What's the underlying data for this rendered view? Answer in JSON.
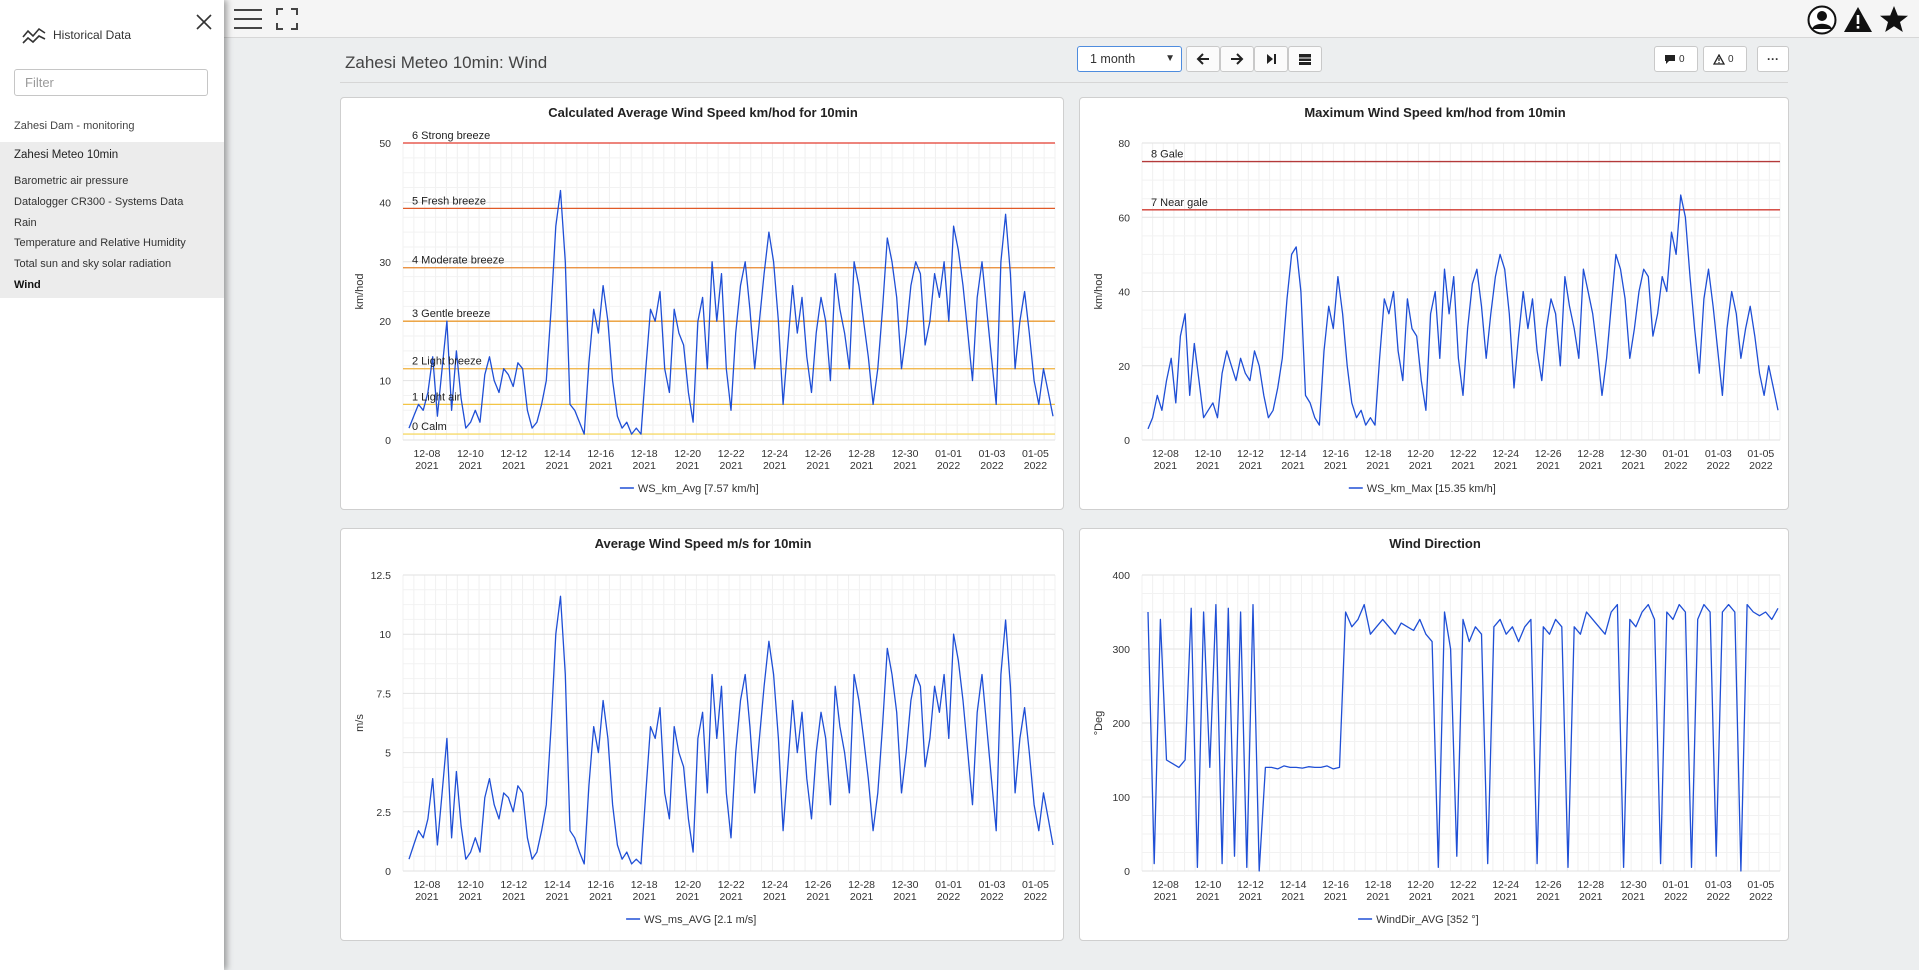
{
  "sidebar": {
    "title": "Historical Data",
    "filter_placeholder": "Filter",
    "section": "Zahesi Dam - monitoring",
    "group": "Zahesi Meteo 10min",
    "items": [
      {
        "label": "Barometric air pressure",
        "active": false
      },
      {
        "label": "Datalogger CR300 - Systems Data",
        "active": false
      },
      {
        "label": "Rain",
        "active": false
      },
      {
        "label": "Temperature and Relative Humidity",
        "active": false
      },
      {
        "label": "Total sun and sky solar radiation",
        "active": false
      },
      {
        "label": "Wind",
        "active": true
      }
    ]
  },
  "toolbar": {
    "icons": [
      "menu-icon",
      "fullscreen-icon",
      "user-icon",
      "warning-icon",
      "star-icon"
    ]
  },
  "page": {
    "title": "Zahesi Meteo 10min: Wind",
    "period": "1 month",
    "comments_count": "0",
    "alarms_count": "0",
    "more_label": "···"
  },
  "colors": {
    "series": "#1f4fd6",
    "accent": "#4e8cde"
  },
  "chart_data": [
    {
      "type": "line",
      "title": "Calculated Average Wind Speed km/hod for 10min",
      "ylabel": "km/hod",
      "ylim": [
        0,
        50
      ],
      "yticks": [
        "0",
        "10",
        "20",
        "30",
        "40",
        "50"
      ],
      "x_ticks": [
        {
          "date": "12-08",
          "year": "2021"
        },
        {
          "date": "12-10",
          "year": "2021"
        },
        {
          "date": "12-12",
          "year": "2021"
        },
        {
          "date": "12-14",
          "year": "2021"
        },
        {
          "date": "12-16",
          "year": "2021"
        },
        {
          "date": "12-18",
          "year": "2021"
        },
        {
          "date": "12-20",
          "year": "2021"
        },
        {
          "date": "12-22",
          "year": "2021"
        },
        {
          "date": "12-24",
          "year": "2021"
        },
        {
          "date": "12-26",
          "year": "2021"
        },
        {
          "date": "12-28",
          "year": "2021"
        },
        {
          "date": "12-30",
          "year": "2021"
        },
        {
          "date": "01-01",
          "year": "2022"
        },
        {
          "date": "01-03",
          "year": "2022"
        },
        {
          "date": "01-05",
          "year": "2022"
        }
      ],
      "x_start": "2021-12-07",
      "x_end": "2022-01-06",
      "series": [
        {
          "name": "WS_km_Avg",
          "legend": "WS_km_Avg [7.57 km/h]",
          "y": [
            2,
            4,
            6,
            5,
            8,
            14,
            4,
            12,
            20,
            5,
            15,
            7,
            2,
            3,
            5,
            3,
            11,
            14,
            10,
            8,
            12,
            11,
            9,
            13,
            12,
            5,
            2,
            3,
            6,
            10,
            22,
            36,
            42,
            30,
            6,
            5,
            3,
            1,
            13,
            22,
            18,
            26,
            20,
            10,
            4,
            2,
            3,
            1,
            2,
            1,
            12,
            22,
            20,
            25,
            12,
            8,
            22,
            18,
            16,
            8,
            3,
            20,
            24,
            12,
            30,
            20,
            28,
            12,
            5,
            18,
            26,
            30,
            22,
            12,
            20,
            28,
            35,
            30,
            20,
            6,
            16,
            26,
            18,
            24,
            14,
            8,
            18,
            24,
            20,
            10,
            28,
            22,
            18,
            12,
            30,
            26,
            20,
            14,
            6,
            12,
            22,
            34,
            30,
            24,
            12,
            18,
            26,
            30,
            28,
            16,
            20,
            28,
            24,
            30,
            20,
            36,
            32,
            26,
            18,
            10,
            24,
            30,
            22,
            14,
            6,
            30,
            38,
            28,
            12,
            20,
            25,
            18,
            10,
            6,
            12,
            8,
            4
          ]
        }
      ],
      "thresholds": [
        {
          "value": 50,
          "label": "6 Strong breeze",
          "color": "#e23a2e"
        },
        {
          "value": 39,
          "label": "5 Fresh breeze",
          "color": "#e05a28"
        },
        {
          "value": 29,
          "label": "4 Moderate breeze",
          "color": "#e8862c"
        },
        {
          "value": 20,
          "label": "3 Gentle breeze",
          "color": "#ec9b30"
        },
        {
          "value": 12,
          "label": "2 Light breeze",
          "color": "#f0b03a"
        },
        {
          "value": 6,
          "label": "1 Light air",
          "color": "#f3c545"
        },
        {
          "value": 1,
          "label": "0 Calm",
          "color": "#f6da6a"
        }
      ]
    },
    {
      "type": "line",
      "title": "Maximum Wind Speed km/hod from 10min",
      "ylabel": "km/hod",
      "ylim": [
        0,
        80
      ],
      "yticks": [
        "0",
        "20",
        "40",
        "60",
        "80"
      ],
      "x_ticks": [
        {
          "date": "12-08",
          "year": "2021"
        },
        {
          "date": "12-10",
          "year": "2021"
        },
        {
          "date": "12-12",
          "year": "2021"
        },
        {
          "date": "12-14",
          "year": "2021"
        },
        {
          "date": "12-16",
          "year": "2021"
        },
        {
          "date": "12-18",
          "year": "2021"
        },
        {
          "date": "12-20",
          "year": "2021"
        },
        {
          "date": "12-22",
          "year": "2021"
        },
        {
          "date": "12-24",
          "year": "2021"
        },
        {
          "date": "12-26",
          "year": "2021"
        },
        {
          "date": "12-28",
          "year": "2021"
        },
        {
          "date": "12-30",
          "year": "2021"
        },
        {
          "date": "01-01",
          "year": "2022"
        },
        {
          "date": "01-03",
          "year": "2022"
        },
        {
          "date": "01-05",
          "year": "2022"
        }
      ],
      "x_start": "2021-12-07",
      "x_end": "2022-01-06",
      "series": [
        {
          "name": "WS_km_Max",
          "legend": "WS_km_Max [15.35 km/h]",
          "y": [
            3,
            6,
            12,
            8,
            16,
            22,
            10,
            28,
            34,
            12,
            26,
            16,
            6,
            8,
            10,
            6,
            18,
            24,
            20,
            16,
            22,
            18,
            16,
            24,
            20,
            12,
            6,
            8,
            14,
            22,
            38,
            50,
            52,
            40,
            12,
            10,
            6,
            4,
            24,
            36,
            30,
            44,
            34,
            20,
            10,
            6,
            8,
            4,
            6,
            4,
            22,
            38,
            34,
            40,
            24,
            16,
            38,
            30,
            28,
            16,
            8,
            34,
            40,
            22,
            46,
            34,
            44,
            22,
            12,
            30,
            42,
            46,
            36,
            22,
            34,
            44,
            50,
            46,
            34,
            14,
            28,
            40,
            30,
            38,
            24,
            16,
            30,
            38,
            34,
            20,
            44,
            36,
            30,
            22,
            46,
            40,
            34,
            24,
            12,
            22,
            36,
            50,
            46,
            38,
            22,
            30,
            40,
            46,
            44,
            28,
            34,
            44,
            40,
            56,
            50,
            66,
            60,
            44,
            30,
            18,
            38,
            46,
            36,
            24,
            12,
            30,
            40,
            34,
            22,
            30,
            36,
            28,
            18,
            12,
            20,
            14,
            8
          ]
        }
      ],
      "thresholds": [
        {
          "value": 75,
          "label": "8 Gale",
          "color": "#b43a3a"
        },
        {
          "value": 62,
          "label": "7 Near gale",
          "color": "#d03a30"
        }
      ]
    },
    {
      "type": "line",
      "title": "Average Wind Speed m/s for 10min",
      "ylabel": "m/s",
      "ylim": [
        0,
        12.5
      ],
      "yticks": [
        "0",
        "2.5",
        "5",
        "7.5",
        "10",
        "12.5"
      ],
      "x_ticks": [
        {
          "date": "12-08",
          "year": "2021"
        },
        {
          "date": "12-10",
          "year": "2021"
        },
        {
          "date": "12-12",
          "year": "2021"
        },
        {
          "date": "12-14",
          "year": "2021"
        },
        {
          "date": "12-16",
          "year": "2021"
        },
        {
          "date": "12-18",
          "year": "2021"
        },
        {
          "date": "12-20",
          "year": "2021"
        },
        {
          "date": "12-22",
          "year": "2021"
        },
        {
          "date": "12-24",
          "year": "2021"
        },
        {
          "date": "12-26",
          "year": "2021"
        },
        {
          "date": "12-28",
          "year": "2021"
        },
        {
          "date": "12-30",
          "year": "2021"
        },
        {
          "date": "01-01",
          "year": "2022"
        },
        {
          "date": "01-03",
          "year": "2022"
        },
        {
          "date": "01-05",
          "year": "2022"
        }
      ],
      "x_start": "2021-12-07",
      "x_end": "2022-01-06",
      "series": [
        {
          "name": "WS_ms_AVG",
          "legend": "WS_ms_AVG [2.1 m/s]",
          "y": [
            0.5,
            1.1,
            1.7,
            1.4,
            2.2,
            3.9,
            1.1,
            3.3,
            5.6,
            1.4,
            4.2,
            1.9,
            0.5,
            0.8,
            1.4,
            0.8,
            3.1,
            3.9,
            2.8,
            2.2,
            3.3,
            3.1,
            2.5,
            3.6,
            3.3,
            1.4,
            0.5,
            0.8,
            1.7,
            2.8,
            6.1,
            10.0,
            11.6,
            8.3,
            1.7,
            1.4,
            0.8,
            0.3,
            3.6,
            6.1,
            5.0,
            7.2,
            5.6,
            2.8,
            1.1,
            0.5,
            0.8,
            0.3,
            0.5,
            0.3,
            3.3,
            6.1,
            5.6,
            6.9,
            3.3,
            2.2,
            6.1,
            5.0,
            4.4,
            2.2,
            0.8,
            5.6,
            6.7,
            3.3,
            8.3,
            5.6,
            7.8,
            3.3,
            1.4,
            5.0,
            7.2,
            8.3,
            6.1,
            3.3,
            5.6,
            7.8,
            9.7,
            8.3,
            5.6,
            1.7,
            4.4,
            7.2,
            5.0,
            6.7,
            3.9,
            2.2,
            5.0,
            6.7,
            5.6,
            2.8,
            7.8,
            6.1,
            5.0,
            3.3,
            8.3,
            7.2,
            5.6,
            3.9,
            1.7,
            3.3,
            6.1,
            9.4,
            8.3,
            6.7,
            3.3,
            5.0,
            7.2,
            8.3,
            7.8,
            4.4,
            5.6,
            7.8,
            6.7,
            8.3,
            5.6,
            10.0,
            8.9,
            7.2,
            5.0,
            2.8,
            6.7,
            8.3,
            6.1,
            3.9,
            1.7,
            8.3,
            10.6,
            7.8,
            3.3,
            5.6,
            6.9,
            5.0,
            2.8,
            1.7,
            3.3,
            2.2,
            1.1
          ]
        }
      ],
      "thresholds": []
    },
    {
      "type": "line",
      "title": "Wind Direction",
      "ylabel": "°Deg",
      "ylim": [
        0,
        400
      ],
      "yticks": [
        "0",
        "100",
        "200",
        "300",
        "400"
      ],
      "x_ticks": [
        {
          "date": "12-08",
          "year": "2021"
        },
        {
          "date": "12-10",
          "year": "2021"
        },
        {
          "date": "12-12",
          "year": "2021"
        },
        {
          "date": "12-14",
          "year": "2021"
        },
        {
          "date": "12-16",
          "year": "2021"
        },
        {
          "date": "12-18",
          "year": "2021"
        },
        {
          "date": "12-20",
          "year": "2021"
        },
        {
          "date": "12-22",
          "year": "2021"
        },
        {
          "date": "12-24",
          "year": "2021"
        },
        {
          "date": "12-26",
          "year": "2021"
        },
        {
          "date": "12-28",
          "year": "2021"
        },
        {
          "date": "12-30",
          "year": "2021"
        },
        {
          "date": "01-01",
          "year": "2022"
        },
        {
          "date": "01-03",
          "year": "2022"
        },
        {
          "date": "01-05",
          "year": "2022"
        }
      ],
      "x_start": "2021-12-07",
      "x_end": "2022-01-06",
      "series": [
        {
          "name": "WindDir_AVG",
          "legend": "WindDir_AVG [352 °]",
          "y": [
            350,
            10,
            340,
            150,
            145,
            140,
            150,
            355,
            5,
            350,
            140,
            360,
            10,
            355,
            20,
            350,
            5,
            360,
            0,
            140,
            140,
            138,
            142,
            140,
            140,
            139,
            141,
            140,
            140,
            142,
            138,
            140,
            350,
            330,
            340,
            360,
            320,
            330,
            340,
            330,
            320,
            335,
            330,
            325,
            340,
            320,
            310,
            5,
            350,
            300,
            20,
            340,
            310,
            330,
            320,
            10,
            330,
            340,
            320,
            330,
            310,
            330,
            340,
            10,
            330,
            320,
            340,
            330,
            5,
            330,
            320,
            350,
            340,
            330,
            320,
            350,
            360,
            5,
            340,
            330,
            350,
            360,
            340,
            10,
            350,
            340,
            360,
            350,
            5,
            340,
            360,
            350,
            20,
            350,
            360,
            350,
            0,
            360,
            350,
            345,
            350,
            340,
            355
          ]
        }
      ],
      "thresholds": []
    }
  ]
}
